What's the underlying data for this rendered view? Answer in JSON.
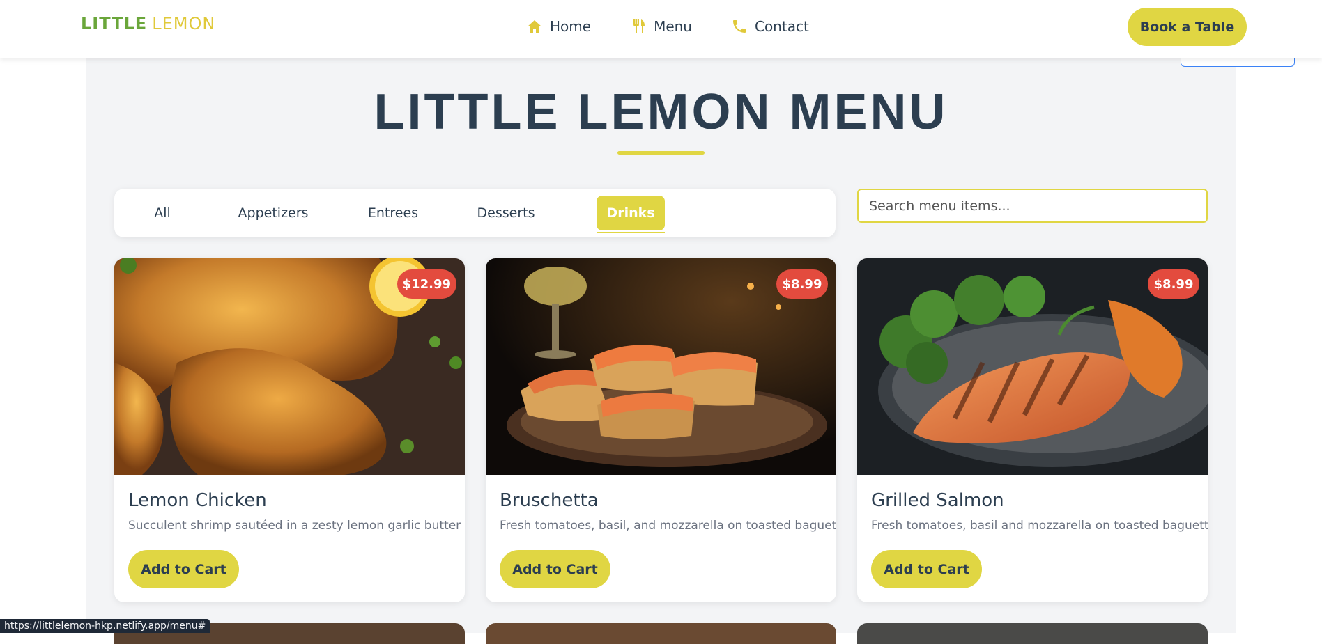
{
  "header": {
    "logo": {
      "word1": "LITTLE",
      "word2": "LEMON"
    },
    "nav": [
      {
        "label": "Home",
        "icon": "home-icon"
      },
      {
        "label": "Menu",
        "icon": "utensils-icon"
      },
      {
        "label": "Contact",
        "icon": "phone-icon"
      }
    ],
    "cta": "Book a Table"
  },
  "page": {
    "title": "LITTLE LEMON MENU"
  },
  "filters": {
    "tabs": [
      "All",
      "Appetizers",
      "Entrees",
      "Desserts",
      "Drinks"
    ],
    "active": "Drinks"
  },
  "search": {
    "placeholder": "Search menu items..."
  },
  "items": [
    {
      "name": "Lemon Chicken",
      "price": "$12.99",
      "description": "Succulent shrimp sautéed in a zesty lemon garlic butter",
      "button": "Add to Cart"
    },
    {
      "name": "Bruschetta",
      "price": "$8.99",
      "description": "Fresh tomatoes, basil, and mozzarella on toasted baguette",
      "button": "Add to Cart"
    },
    {
      "name": "Grilled Salmon",
      "price": "$8.99",
      "description": "Fresh tomatoes, basil and mozzarella on toasted baguette",
      "button": "Add to Cart"
    }
  ],
  "status_bar": {
    "url": "https://littlelemon-hkp.netlify.app/menu#"
  },
  "colors": {
    "accent": "#e0d643",
    "price_badge": "#e34b3e",
    "text": "#2c3e50",
    "panel": "#f3f4f6"
  }
}
